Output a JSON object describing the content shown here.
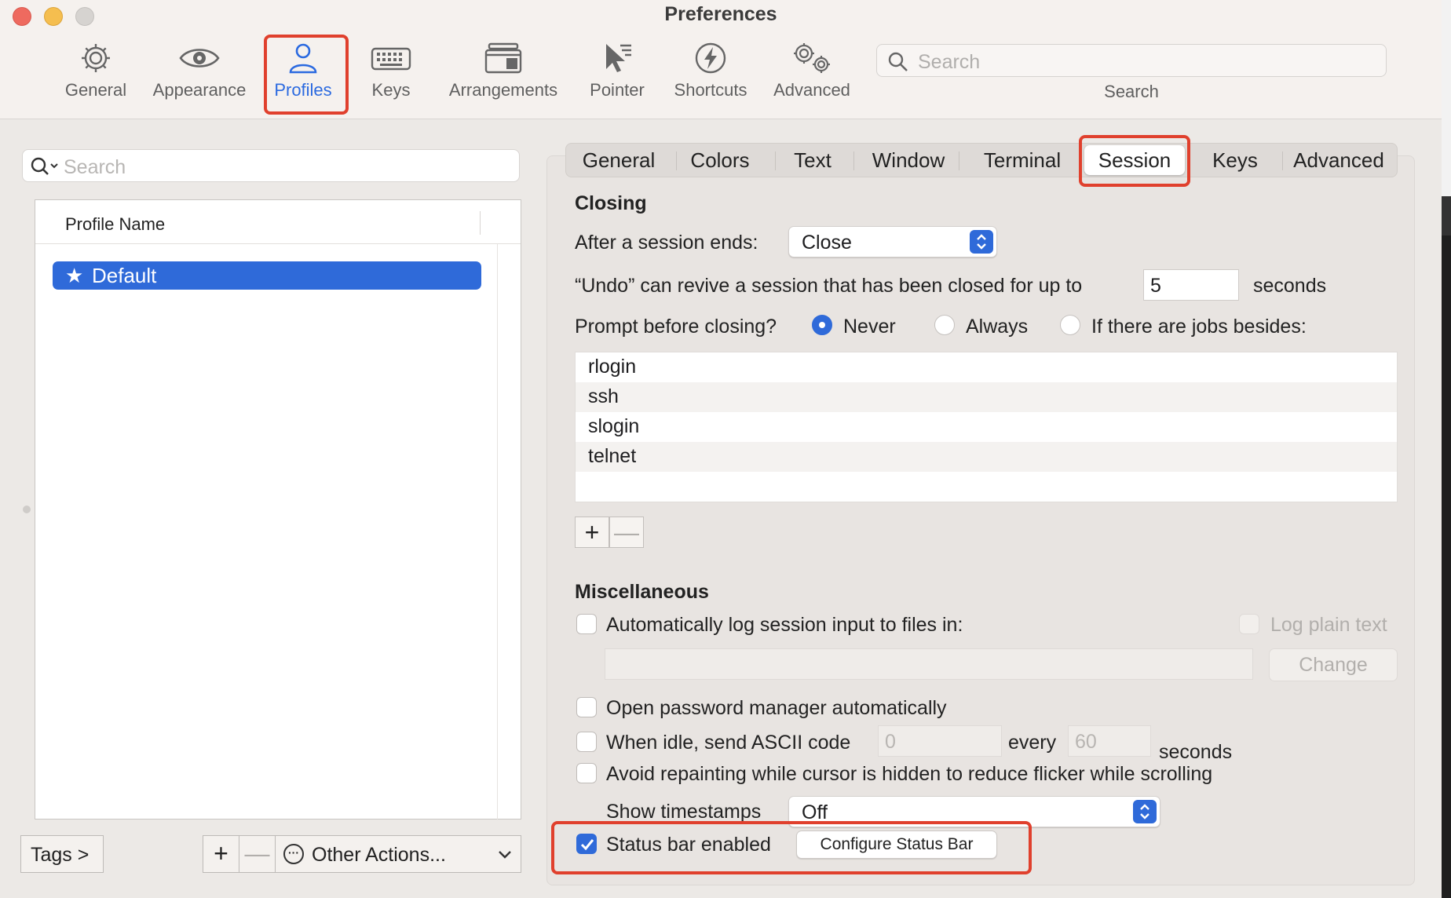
{
  "window": {
    "title": "Preferences"
  },
  "toolbar": {
    "items": [
      {
        "label": "General",
        "icon": "gear-icon"
      },
      {
        "label": "Appearance",
        "icon": "eye-icon"
      },
      {
        "label": "Profiles",
        "icon": "person-icon"
      },
      {
        "label": "Keys",
        "icon": "keyboard-icon"
      },
      {
        "label": "Arrangements",
        "icon": "window-stack-icon"
      },
      {
        "label": "Pointer",
        "icon": "pointer-icon"
      },
      {
        "label": "Shortcuts",
        "icon": "lightning-icon"
      },
      {
        "label": "Advanced",
        "icon": "gears-icon"
      }
    ],
    "active": "Profiles",
    "search_placeholder": "Search",
    "search_caption": "Search"
  },
  "profiles": {
    "search_placeholder": "Search",
    "column_header": "Profile Name",
    "rows": [
      {
        "name": "Default",
        "starred": true
      }
    ],
    "tags_label": "Tags >",
    "add_label": "+",
    "remove_label": "—",
    "other_actions_label": "Other Actions..."
  },
  "tabs": {
    "items": [
      "General",
      "Colors",
      "Text",
      "Window",
      "Terminal",
      "Session",
      "Keys",
      "Advanced"
    ],
    "active": "Session"
  },
  "closing": {
    "title": "Closing",
    "after_label": "After a session ends:",
    "after_value": "Close",
    "undo_prefix": "“Undo” can revive a session that has been closed for up to",
    "undo_value": "5",
    "undo_suffix": "seconds",
    "prompt_label": "Prompt before closing?",
    "prompt_options": [
      "Never",
      "Always",
      "If there are jobs besides:"
    ],
    "prompt_selected": "Never",
    "jobs": [
      "rlogin",
      "ssh",
      "slogin",
      "telnet"
    ],
    "add_label": "+",
    "remove_label": "—"
  },
  "misc": {
    "title": "Miscellaneous",
    "log_label": "Automatically log session input to files in:",
    "log_checked": false,
    "log_plain_label": "Log plain text",
    "change_label": "Change",
    "password_label": "Open password manager automatically",
    "password_checked": false,
    "idle_label": "When idle, send ASCII code",
    "idle_code": "0",
    "idle_every": "every",
    "idle_seconds_value": "60",
    "idle_seconds_label": "seconds",
    "idle_checked": false,
    "repaint_label": "Avoid repainting while cursor is hidden to reduce flicker while scrolling",
    "repaint_checked": false,
    "timestamps_label": "Show timestamps",
    "timestamps_value": "Off",
    "statusbar_label": "Status bar enabled",
    "statusbar_checked": true,
    "configure_label": "Configure Status Bar"
  },
  "colors": {
    "accent": "#2f6ad9",
    "highlight": "#e0402d"
  }
}
